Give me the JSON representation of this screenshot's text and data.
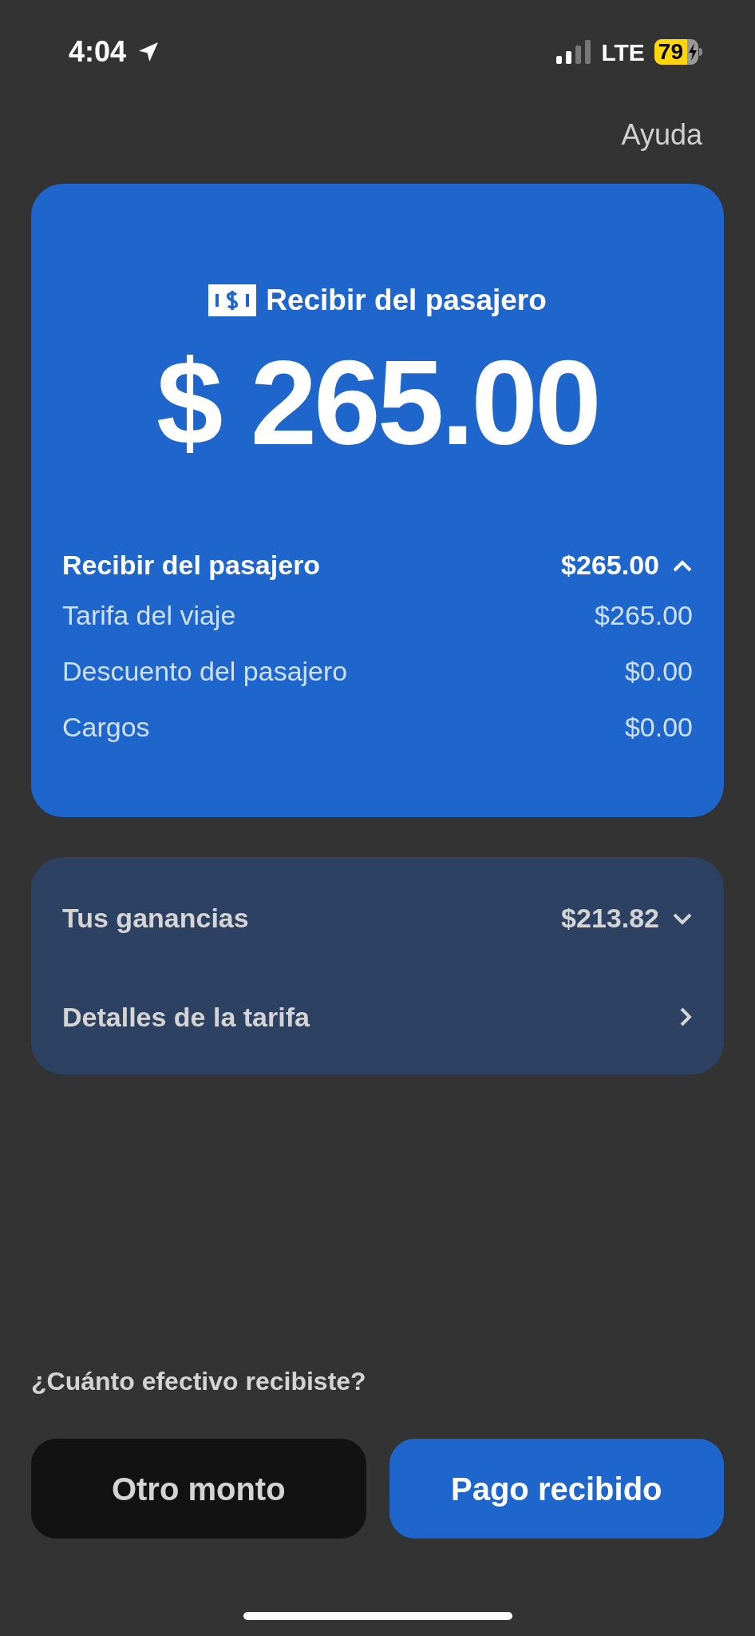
{
  "status_bar": {
    "time": "4:04",
    "network": "LTE",
    "battery": "79"
  },
  "help_link": "Ayuda",
  "payment_card": {
    "heading": "Recibir del pasajero",
    "amount": "$ 265.00",
    "summary": {
      "label": "Recibir del pasajero",
      "value": "$265.00",
      "expanded": true
    },
    "rows": [
      {
        "label": "Tarifa del viaje",
        "value": "$265.00"
      },
      {
        "label": "Descuento del pasajero",
        "value": "$0.00"
      },
      {
        "label": "Cargos",
        "value": "$0.00"
      }
    ]
  },
  "earnings_card": {
    "earnings": {
      "label": "Tus ganancias",
      "value": "$213.82",
      "expanded": false
    },
    "details_link": "Detalles de la tarifa"
  },
  "question": "¿Cuánto efectivo recibiste?",
  "buttons": [
    {
      "label": "Otro monto",
      "kind": "secondary"
    },
    {
      "label": "Pago recibido",
      "kind": "primary"
    }
  ]
}
